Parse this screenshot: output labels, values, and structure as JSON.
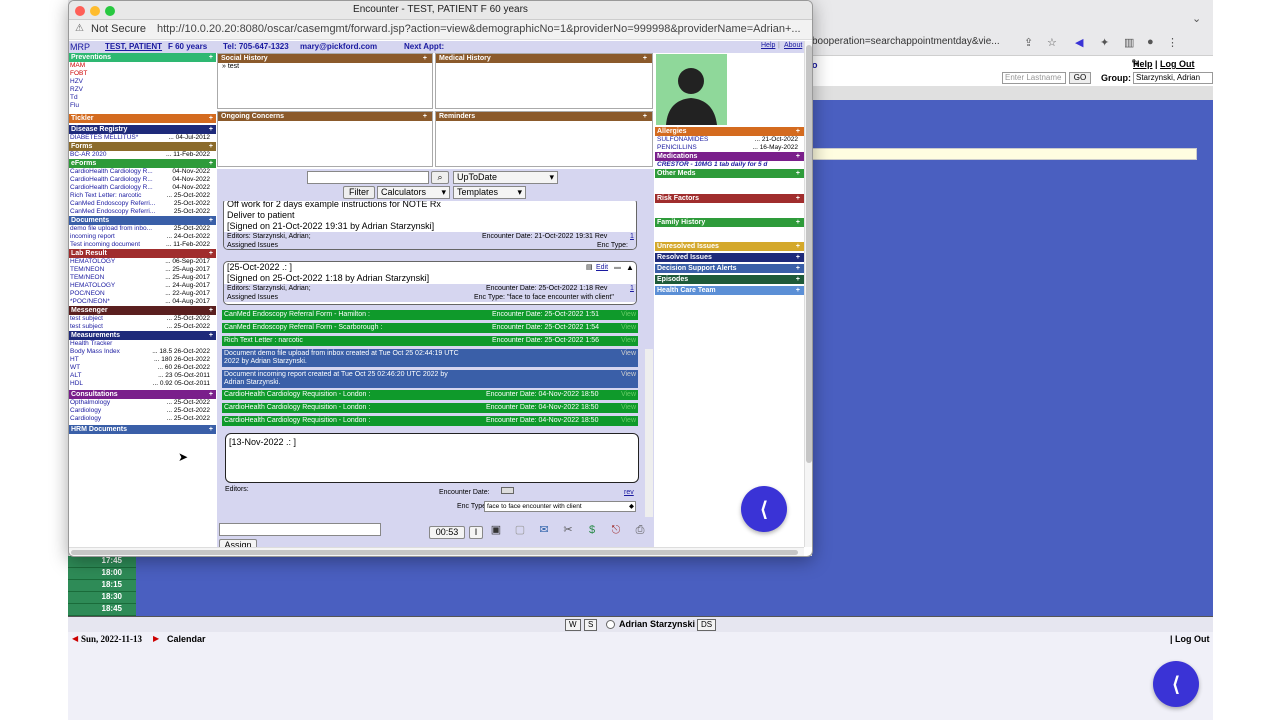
{
  "window": {
    "title": "Encounter - TEST, PATIENT F 60 years",
    "not_secure": "Not Secure",
    "url": "http://10.0.20.20:8080/oscar/casemgmt/forward.jsp?action=view&demographicNo=1&providerNo=999998&providerName=Adrian+..."
  },
  "background": {
    "url_fragment": "booperation=searchappointmentday&vie...",
    "help": "Help",
    "logout_top": "Log Out",
    "o_link": "o",
    "lastname_placeholder": "Enter Lastname",
    "go": "GO",
    "group_label": "Group:",
    "group_value": "Starzynski, Adrian",
    "times": [
      "17:45",
      "18:00",
      "18:15",
      "18:30",
      "18:45"
    ],
    "btn_w": "W",
    "btn_s": "S",
    "provider": "Adrian Starzynski",
    "btn_ds": "DS",
    "date": "Sun, 2022-11-13",
    "calendar": "Calendar",
    "logout_bottom": "| Log Out"
  },
  "header": {
    "mrp": "MRP",
    "patient": "TEST, PATIENT",
    "sexage": "F 60 years",
    "tel": "Tel: 705-647-1323",
    "email": "mary@pickford.com",
    "next_appt": "Next Appt:",
    "help": "Help",
    "about": "About"
  },
  "left": {
    "preventions": {
      "title": "Preventions",
      "items": [
        "MAM",
        "FOBT",
        "HZV",
        "RZV",
        "Td",
        "Flu"
      ]
    },
    "tickler": {
      "title": "Tickler"
    },
    "disease": {
      "title": "Disease Registry",
      "items": [
        {
          "label": "DIABETES MELLITUS*",
          "date": "... 04-Jul-2012"
        }
      ]
    },
    "forms": {
      "title": "Forms",
      "items": [
        {
          "label": "BC-AR 2020",
          "date": "... 11-Feb-2022"
        }
      ]
    },
    "eforms": {
      "title": "eForms",
      "items": [
        {
          "label": "CardioHealth Cardiology R...",
          "date": "04-Nov-2022"
        },
        {
          "label": "CardioHealth Cardiology R...",
          "date": "04-Nov-2022"
        },
        {
          "label": "CardioHealth Cardiology R...",
          "date": "04-Nov-2022"
        },
        {
          "label": "Rich Text Letter: narcotic",
          "date": "... 25-Oct-2022"
        },
        {
          "label": "CanMed Endoscopy Referri...",
          "date": "25-Oct-2022"
        },
        {
          "label": "CanMed Endoscopy Referri...",
          "date": "25-Oct-2022"
        }
      ]
    },
    "documents": {
      "title": "Documents",
      "items": [
        {
          "label": "demo file upload from inbo...",
          "date": "25-Oct-2022"
        },
        {
          "label": "incoming report",
          "date": "... 24-Oct-2022"
        },
        {
          "label": "Test incoming document",
          "date": "... 11-Feb-2022"
        }
      ]
    },
    "labs": {
      "title": "Lab Result",
      "items": [
        {
          "label": "HEMATOLOGY",
          "date": "... 06-Sep-2017"
        },
        {
          "label": "TEM/NEON",
          "date": "... 25-Aug-2017"
        },
        {
          "label": "TEM/NEON",
          "date": "... 25-Aug-2017"
        },
        {
          "label": "HEMATOLOGY",
          "date": "... 24-Aug-2017"
        },
        {
          "label": "POC/NEON",
          "date": "... 22-Aug-2017"
        },
        {
          "label": "*POC/NEON*",
          "date": "... 04-Aug-2017"
        }
      ]
    },
    "messenger": {
      "title": "Messenger",
      "items": [
        {
          "label": "test subject",
          "date": "... 25-Oct-2022"
        },
        {
          "label": "test subject",
          "date": "... 25-Oct-2022"
        }
      ]
    },
    "measurements": {
      "title": "Measurements",
      "items": [
        {
          "label": "Health Tracker",
          "date": ""
        },
        {
          "label": "Body Mass Index",
          "date": "... 18.5 26-Oct-2022"
        },
        {
          "label": "HT",
          "date": "... 180 26-Oct-2022"
        },
        {
          "label": "WT",
          "date": "... 60 26-Oct-2022"
        },
        {
          "label": "ALT",
          "date": "... 23 05-Oct-2011"
        },
        {
          "label": "HDL",
          "date": "... 0.92 05-Oct-2011"
        }
      ]
    },
    "consultations": {
      "title": "Consultations",
      "items": [
        {
          "label": "Opthalmology",
          "date": "... 25-Oct-2022"
        },
        {
          "label": "Cardiology",
          "date": "... 25-Oct-2022"
        },
        {
          "label": "Cardiology",
          "date": "... 25-Oct-2022"
        }
      ]
    },
    "hrm": {
      "title": "HRM Documents"
    }
  },
  "center": {
    "social_history": "Social History",
    "social_item": "test",
    "medical_history": "Medical History",
    "ongoing_concerns": "Ongoing Concerns",
    "reminders": "Reminders",
    "search_value": "",
    "uptodate": "UpToDate",
    "filter": "Filter",
    "calculators": "Calculators",
    "templates": "Templates",
    "note1": {
      "line1": "Off work for 2 days example instructions for NOTE Rx",
      "line2": "Deliver to patient",
      "line3": "[Signed on 21-Oct-2022 19:31 by Adrian Starzynski]",
      "editors": "Editors: Starzynski, Adrian;",
      "enc_date": "Encounter Date:  21-Oct-2022 19:31  Rev",
      "rev": "1",
      "assigned": "Assigned Issues",
      "enc_type": "Enc Type:"
    },
    "note2": {
      "line1": "[25-Oct-2022 .: ]",
      "edit": "Edit",
      "line2": "[Signed on 25-Oct-2022 1:18 by Adrian Starzynski]",
      "editors": "Editors: Starzynski, Adrian;",
      "enc_date": "Encounter Date:  25-Oct-2022 1:18  Rev",
      "rev": "1",
      "assigned": "Assigned Issues",
      "enc_type": "Enc Type:  \"face to face encounter with client\""
    },
    "greenbars": [
      {
        "label": "CanMed Endoscopy Referral Form - Hamilton :",
        "date": "Encounter Date:  25-Oct-2022 1:51",
        "view": "View"
      },
      {
        "label": "CanMed Endoscopy Referral Form - Scarborough :",
        "date": "Encounter Date:  25-Oct-2022 1:54",
        "view": "View"
      },
      {
        "label": "Rich Text Letter : narcotic",
        "date": "Encounter Date:  25-Oct-2022 1:56",
        "view": "View"
      }
    ],
    "bluebars": [
      {
        "l1": "Document demo file upload from inbox created at Tue Oct 25 02:44:19 UTC",
        "l2": "2022 by Adrian Starzynski.",
        "view": "View"
      },
      {
        "l1": "Document incoming report created at Tue Oct 25 02:46:20 UTC 2022 by",
        "l2": "Adrian Starzynski.",
        "view": "View"
      }
    ],
    "greenbars2": [
      {
        "label": "CardioHealth Cardiology Requisition - London :",
        "date": "Encounter Date:  04-Nov-2022 18:50",
        "view": "View"
      },
      {
        "label": "CardioHealth Cardiology Requisition - London :",
        "date": "Encounter Date:  04-Nov-2022 18:50",
        "view": "View"
      },
      {
        "label": "CardioHealth Cardiology Requisition - London :",
        "date": "Encounter Date:  04-Nov-2022 18:50",
        "view": "View"
      }
    ],
    "new_note": {
      "text": "[13-Nov-2022 .: ]",
      "editors": "Editors:",
      "enc_date": "Encounter Date:",
      "rev": "rev",
      "enc_type_label": "Enc Type:",
      "enc_type_value": "face to face encounter with client"
    },
    "timer": "00:53",
    "pause": "I",
    "assign": "Assign"
  },
  "right": {
    "allergies": {
      "title": "Allergies",
      "items": [
        {
          "label": "SULFONAMIDES",
          "date": "... 21-Oct-2022"
        },
        {
          "label": "PENICILLINS",
          "date": "... 16-May-2022"
        }
      ]
    },
    "medications": {
      "title": "Medications",
      "item": "CRESTOR - 10MG 1 tab daily for 5 d"
    },
    "other_meds": "Other Meds",
    "risk_factors": "Risk Factors",
    "family_history": "Family History",
    "unresolved": "Unresolved Issues",
    "resolved": "Resolved Issues",
    "decision": "Decision Support Alerts",
    "episodes": "Episodes",
    "care_team": "Health Care Team"
  },
  "colors": {
    "green": "#0f9a2b",
    "brown": "#8b5a2b",
    "navy": "#1e2a7a",
    "bg_blue": "#4a5fc0",
    "fab": "#3a33d6"
  }
}
